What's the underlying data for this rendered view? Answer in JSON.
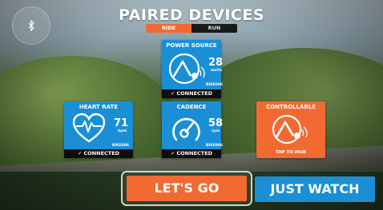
{
  "header": {
    "title": "PAIRED DEVICES"
  },
  "sport_toggle": {
    "options": [
      "RIDE",
      "RUN"
    ],
    "selected": "RIDE"
  },
  "bluetooth": {
    "icon": "bluetooth-icon"
  },
  "cards": {
    "power": {
      "title": "POWER SOURCE",
      "value": "28",
      "unit": "watts",
      "device": "BIKE006",
      "status": "CONNECTED",
      "icon": "power-gauge-icon"
    },
    "heart": {
      "title": "HEART RATE",
      "value": "71",
      "unit": "bpm",
      "device": "BIKE006",
      "status": "CONNECTED",
      "icon": "heart-pulse-icon"
    },
    "cadence": {
      "title": "CADENCE",
      "value": "58",
      "unit": "rpm",
      "device": "BIKE006",
      "status": "CONNECTED",
      "icon": "cadence-dial-icon"
    },
    "controllable": {
      "title": "CONTROLLABLE",
      "action": "TAP TO PAIR",
      "icon": "controllable-trainer-icon"
    }
  },
  "actions": {
    "lets_go": "LET'S GO",
    "just_watch": "JUST WATCH"
  },
  "colors": {
    "orange": "#f26a32",
    "blue": "#1a8fd6",
    "connected_check": "#8ad14b"
  }
}
